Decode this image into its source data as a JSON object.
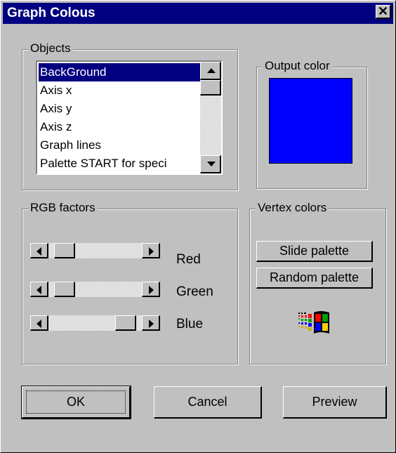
{
  "window": {
    "title": "Graph Colous"
  },
  "objects_group": {
    "label": "Objects",
    "items": [
      "BackGround",
      "Axis x",
      "Axis y",
      "Axis z",
      "Graph lines",
      "Palette START for speci"
    ],
    "selected_index": 0
  },
  "output_group": {
    "label": "Output color",
    "color": "#0000ff"
  },
  "rgb_group": {
    "label": "RGB factors",
    "sliders": [
      {
        "label": "Red",
        "value": 0.08
      },
      {
        "label": "Green",
        "value": 0.08
      },
      {
        "label": "Blue",
        "value": 0.92
      }
    ]
  },
  "vertex_group": {
    "label": "Vertex colors",
    "slide_label": "Slide palette",
    "random_label": "Random palette",
    "logo_icon": "windows-logo-icon"
  },
  "buttons": {
    "ok": "OK",
    "cancel": "Cancel",
    "preview": "Preview"
  }
}
